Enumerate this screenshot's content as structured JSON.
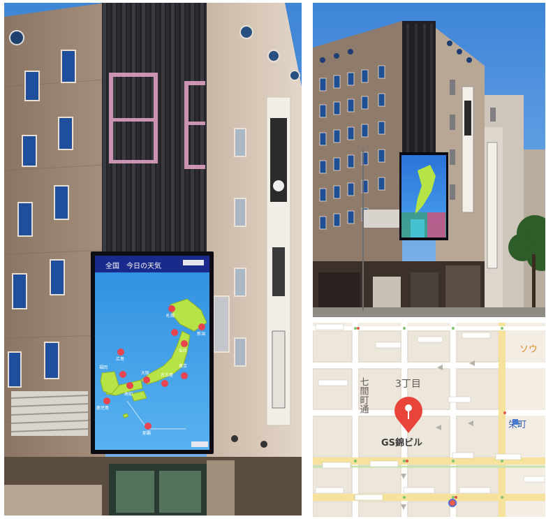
{
  "left_photo": {
    "screen_header": "全国　今日の天気",
    "city_labels": [
      "札幌",
      "新潟",
      "仙台",
      "広島",
      "東京",
      "名古屋",
      "福岡",
      "大阪",
      "高知",
      "鹿児島",
      "那覇"
    ]
  },
  "map": {
    "district_label": "3丁目",
    "street_label": "七間町通",
    "building_label": "GS錦ビル",
    "station_label_partial": "栄町",
    "area_label_partial": "ソウ",
    "colors": {
      "pin": "#e8443a",
      "bg": "#f3ede3",
      "major_road": "#f6e29a"
    }
  }
}
